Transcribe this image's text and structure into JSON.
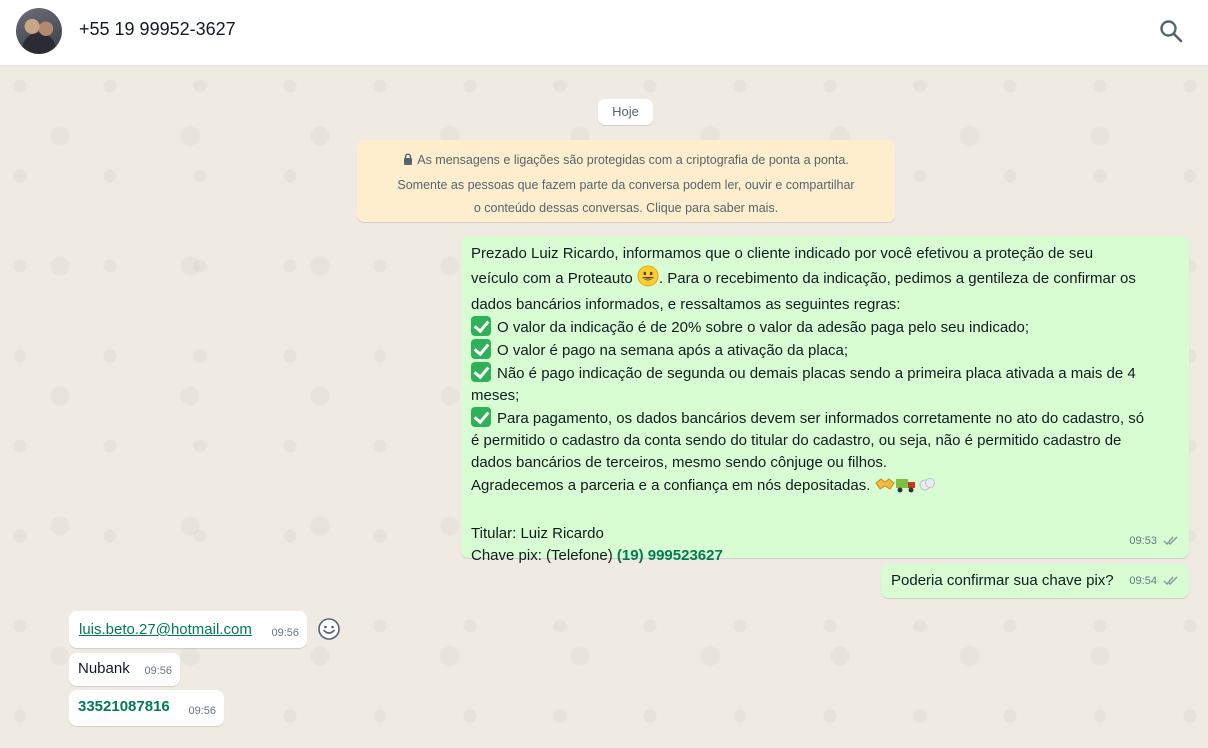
{
  "header": {
    "contact": "+55 19 99952-3627",
    "search_icon": "search-icon",
    "avatar": "avatar"
  },
  "chat": {
    "date_label": "Hoje",
    "encryption_notice": {
      "icon": "lock-icon",
      "line1": "As mensagens e ligações são protegidas com a criptografia de ponta a ponta.",
      "line2": "Somente as pessoas que fazem parte da conversa podem ler, ouvir e compartilhar",
      "line3": "o conteúdo dessas conversas. Clique para saber mais."
    },
    "messages": [
      {
        "direction": "outgoing",
        "lines": [
          "Prezado Luiz Ricardo, informamos que o cliente indicado por você efetivou a proteção de seu",
          "veículo com a Proteauto",
          ". Para o recebimento da indicação, pedimos a gentileza de confirmar os",
          "dados bancários informados, e  ressaltamos as seguintes regras:",
          "O valor da indicação é de 20% sobre o valor da adesão paga pelo seu indicado;",
          "O valor é pago na semana após a ativação da placa;",
          "Não é pago indicação de segunda ou demais placas sendo a primeira placa ativada a mais de 4",
          "meses;",
          "Para pagamento, os dados bancários devem ser informados corretamente no ato do cadastro, só",
          "é permitido o cadastro da conta sendo do titular do cadastro, ou seja, não é permitido cadastro de",
          "dados bancários de terceiros, mesmo sendo cônjuge ou filhos.",
          "Agradecemos a parceria e a confiança em nós depositadas.",
          "Titular: Luiz Ricardo",
          "Chave pix: (Telefone) ",
          "(19) 999523627"
        ],
        "time": "09:53",
        "status_icon": "double-check-icon"
      },
      {
        "direction": "outgoing",
        "text": "Poderia confirmar sua chave pix?",
        "time": "09:54",
        "status_icon": "double-check-icon"
      },
      {
        "direction": "incoming",
        "text": "luis.beto.27@hotmail.com",
        "time": "09:56",
        "reaction_icon": "emoji-reaction-icon"
      },
      {
        "direction": "incoming",
        "text": "Nubank",
        "time": "09:56"
      },
      {
        "direction": "incoming",
        "text": "33521087816",
        "time": "09:56"
      }
    ]
  },
  "colors": {
    "outgoing_bubble": "#d9fdd3",
    "incoming_bubble": "#ffffff",
    "chat_background": "#efeae2",
    "notice_background": "#ffeecd",
    "accent_green": "#027b55"
  }
}
